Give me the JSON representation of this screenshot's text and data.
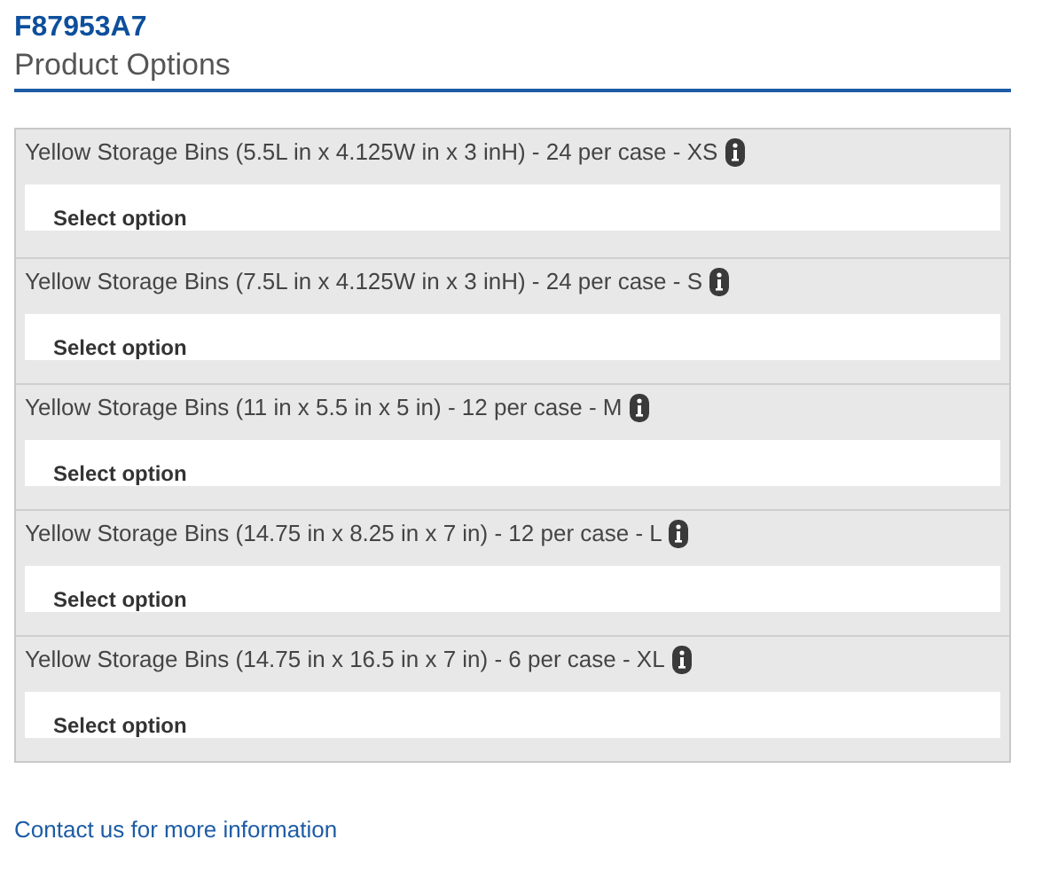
{
  "product_code": "F87953A7",
  "heading": "Product Options",
  "options": [
    {
      "label": "Yellow Storage Bins (5.5L in x 4.125W in x 3 inH) - 24 per case - XS",
      "select": "Select option"
    },
    {
      "label": "Yellow Storage Bins (7.5L in x 4.125W in x 3 inH) - 24 per case - S",
      "select": "Select option"
    },
    {
      "label": "Yellow Storage Bins (11 in x 5.5 in x 5 in) - 12 per case - M",
      "select": "Select option"
    },
    {
      "label": "Yellow Storage Bins (14.75 in x 8.25 in x 7 in) - 12 per case - L",
      "select": "Select option"
    },
    {
      "label": "Yellow Storage Bins (14.75 in x 16.5 in x 7 in) - 6 per case - XL",
      "select": "Select option"
    }
  ],
  "contact_link": "Contact us for more information"
}
